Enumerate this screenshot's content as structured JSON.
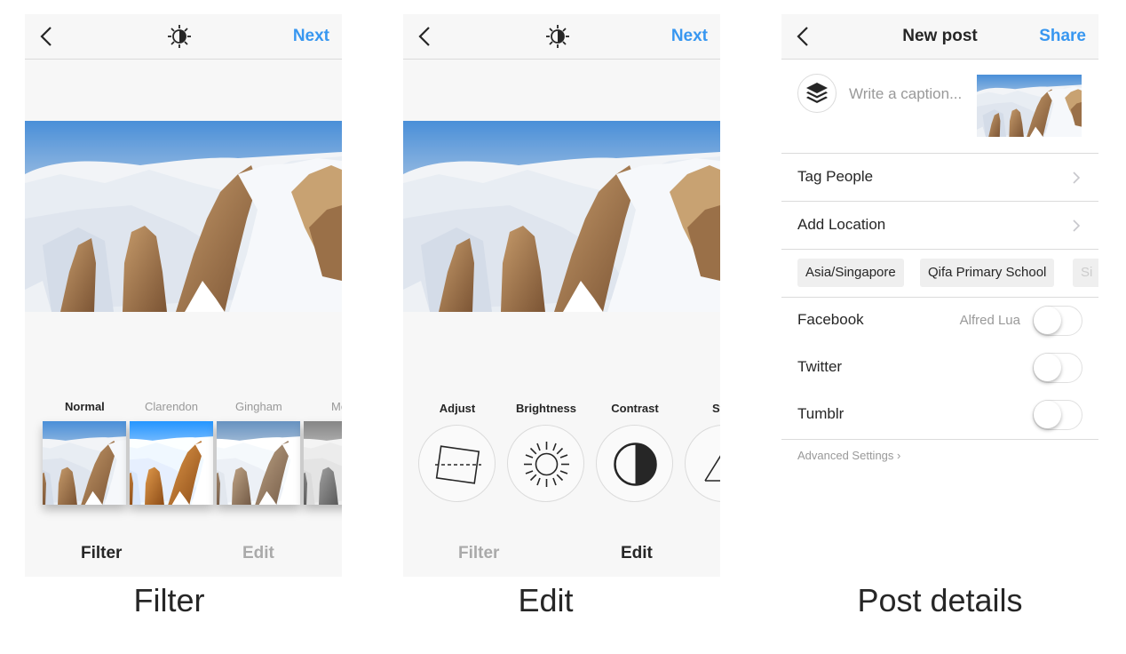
{
  "screens": {
    "filter": {
      "next_label": "Next",
      "filters": [
        "Normal",
        "Clarendon",
        "Gingham",
        "Mo"
      ],
      "tabs": {
        "filter": "Filter",
        "edit": "Edit"
      },
      "caption": "Filter"
    },
    "edit": {
      "next_label": "Next",
      "tools": [
        "Adjust",
        "Brightness",
        "Contrast",
        "Stru"
      ],
      "tabs": {
        "filter": "Filter",
        "edit": "Edit"
      },
      "caption": "Edit"
    },
    "post": {
      "title": "New post",
      "share_label": "Share",
      "caption_placeholder": "Write a caption...",
      "tag_people": "Tag People",
      "add_location": "Add Location",
      "location_chips": [
        "Asia/Singapore",
        "Qifa Primary School",
        "Si"
      ],
      "share_targets": [
        {
          "name": "Facebook",
          "account": "Alfred Lua"
        },
        {
          "name": "Twitter",
          "account": ""
        },
        {
          "name": "Tumblr",
          "account": ""
        }
      ],
      "advanced_settings": "Advanced Settings ›",
      "caption": "Post details"
    }
  },
  "colors": {
    "accent": "#3897f0",
    "text": "#262626",
    "muted": "#999999",
    "divider": "#dbdbdb"
  }
}
